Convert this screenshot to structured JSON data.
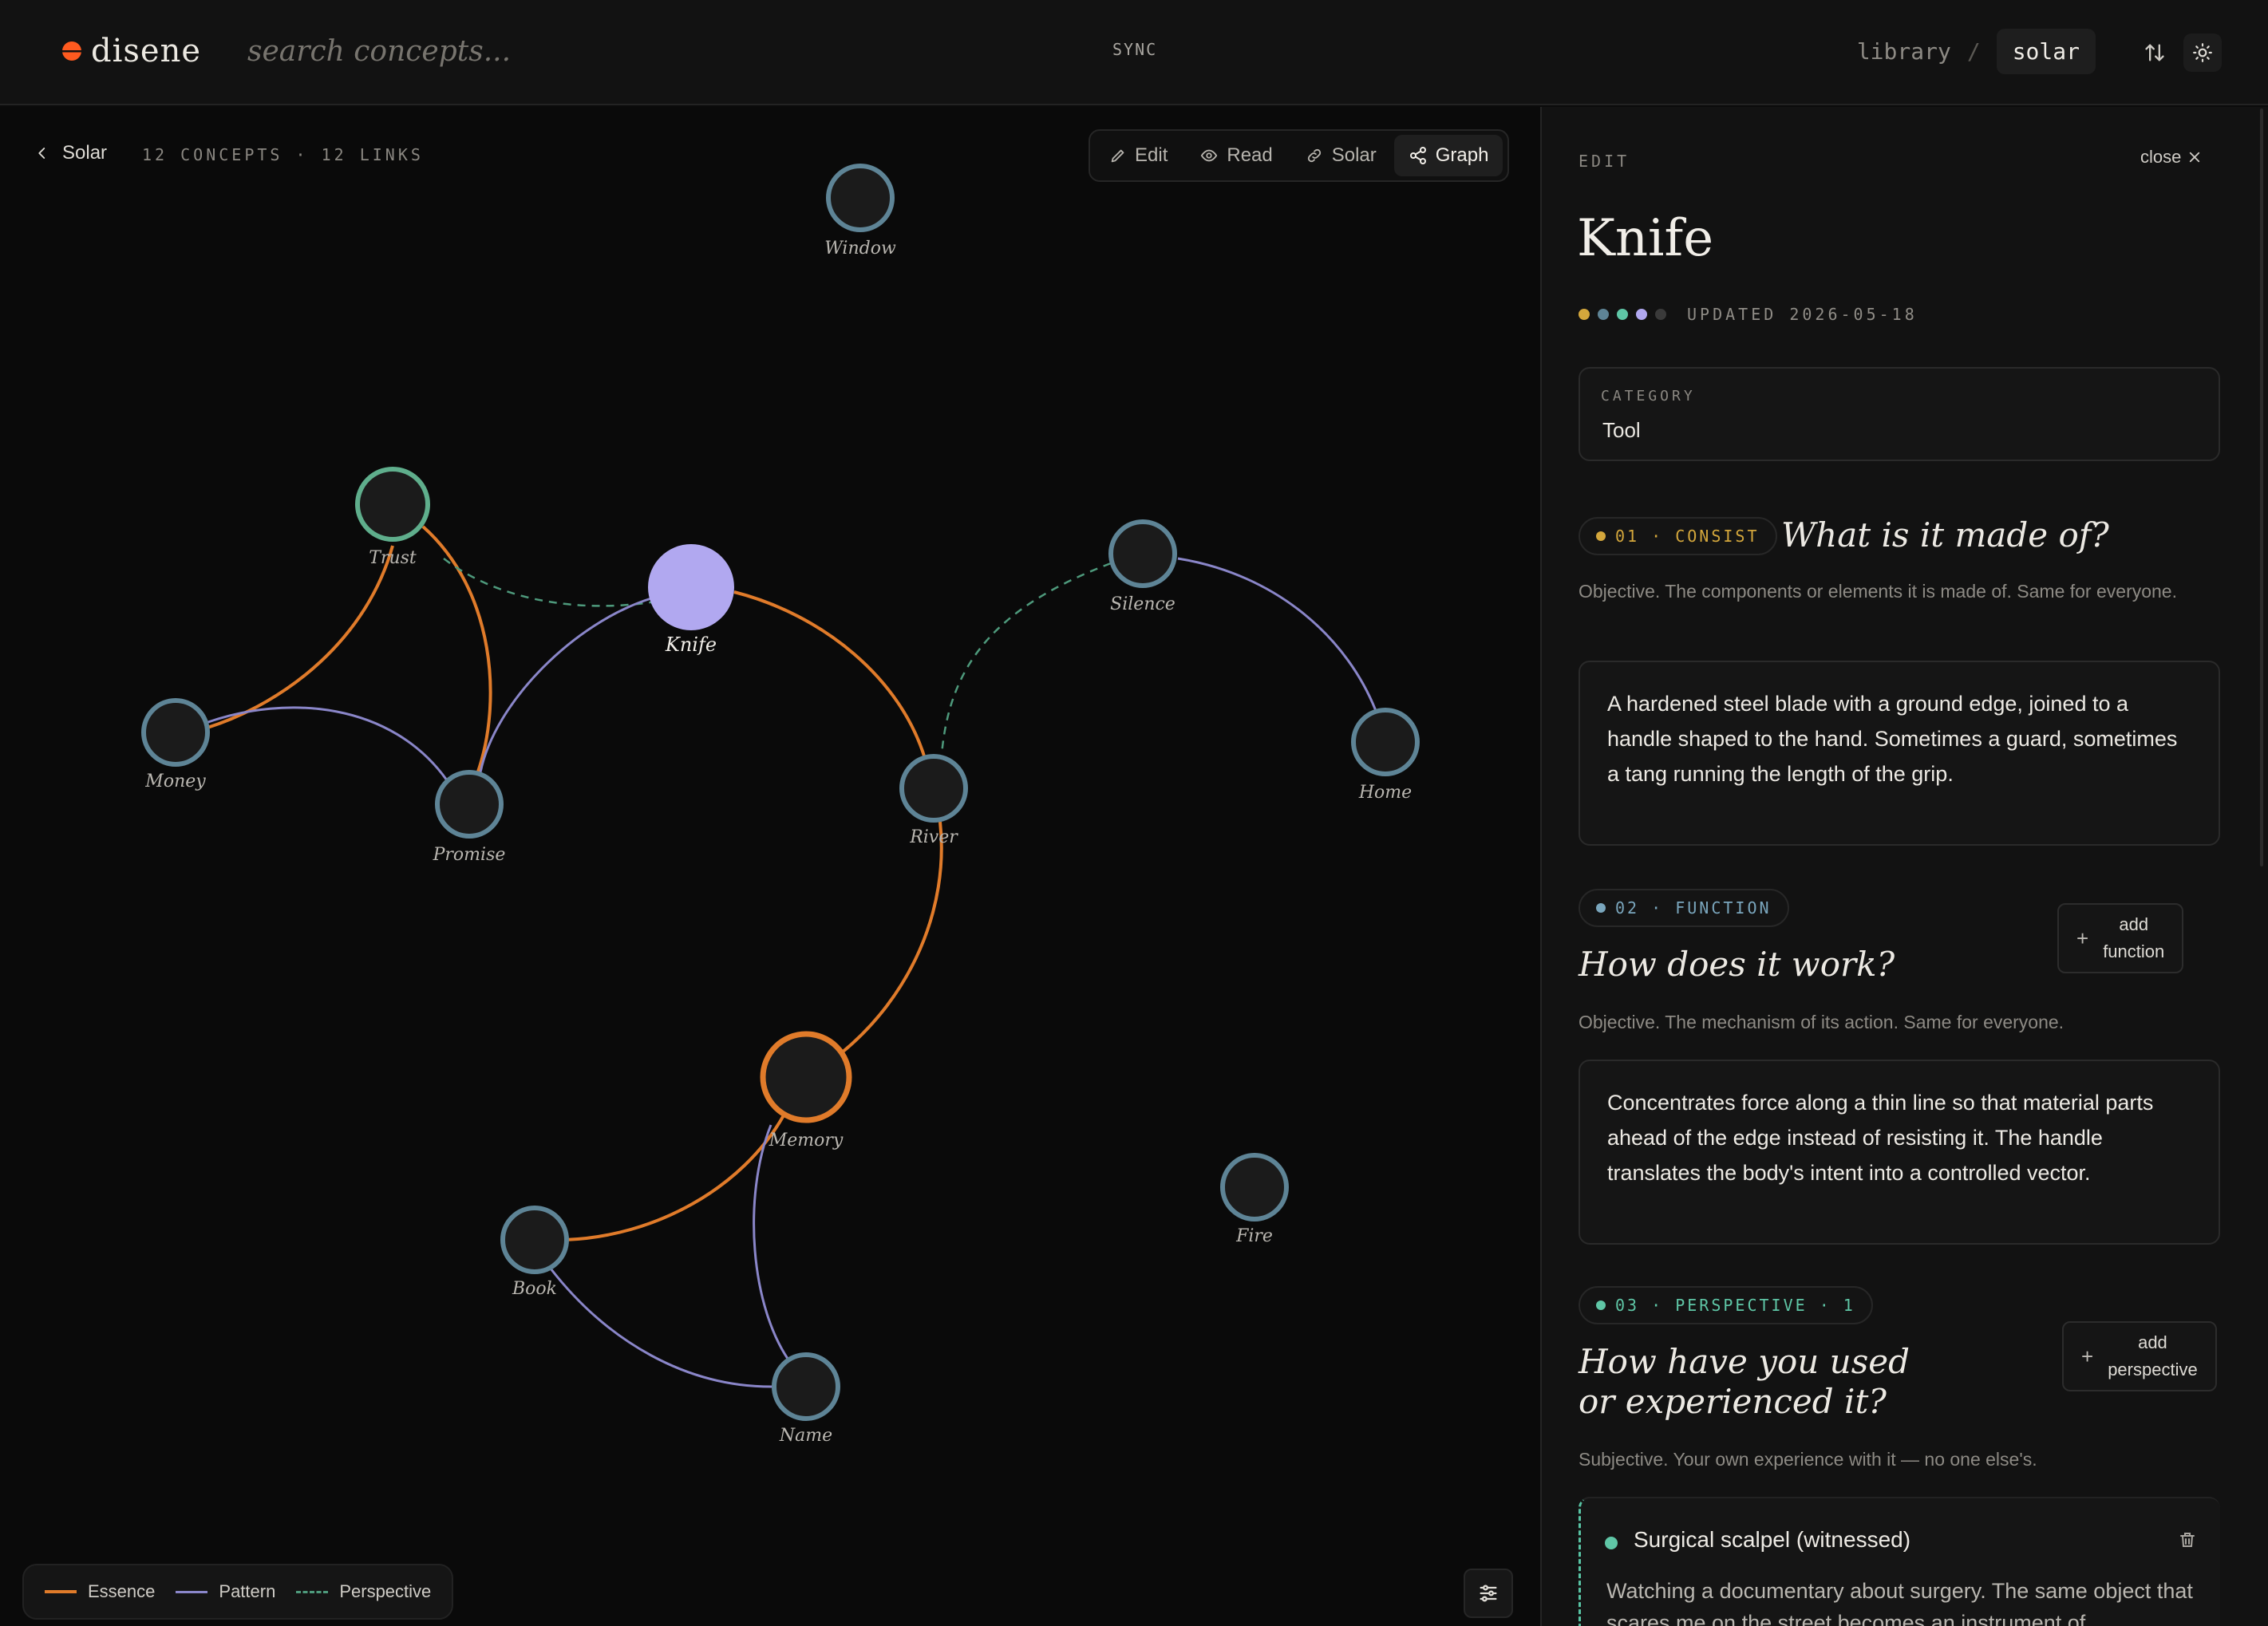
{
  "app": {
    "logo_text": "disene",
    "search_placeholder": "search concepts...",
    "sync_label": "SYNC"
  },
  "breadcrumb": {
    "library": "library",
    "separator": "/",
    "current": "solar"
  },
  "graph_header": {
    "back_label": "Solar",
    "stats": "12 CONCEPTS · 12 LINKS"
  },
  "modes": [
    {
      "label": "Edit",
      "icon": "pencil-icon",
      "active": false
    },
    {
      "label": "Read",
      "icon": "eye-icon",
      "active": false
    },
    {
      "label": "Solar",
      "icon": "link-icon",
      "active": false
    },
    {
      "label": "Graph",
      "icon": "share-icon",
      "active": true
    }
  ],
  "legend": [
    {
      "label": "Essence",
      "color": "#e07b2a",
      "style": "solid"
    },
    {
      "label": "Pattern",
      "color": "#8a86c9",
      "style": "solid"
    },
    {
      "label": "Perspective",
      "color": "#4e9a7c",
      "style": "dashed"
    }
  ],
  "colors": {
    "essence": "#e07b2a",
    "pattern": "#8a86c9",
    "perspective": "#4e9a7c",
    "node_default": "#5e8496",
    "node_trust": "#5fae8c",
    "node_memory": "#e07b2a",
    "node_selected": "#b1a8f0"
  },
  "nodes": [
    {
      "id": "window",
      "label": "Window"
    },
    {
      "id": "trust",
      "label": "Trust"
    },
    {
      "id": "knife",
      "label": "Knife"
    },
    {
      "id": "silence",
      "label": "Silence"
    },
    {
      "id": "money",
      "label": "Money"
    },
    {
      "id": "home",
      "label": "Home"
    },
    {
      "id": "promise",
      "label": "Promise"
    },
    {
      "id": "river",
      "label": "River"
    },
    {
      "id": "memory",
      "label": "Memory"
    },
    {
      "id": "fire",
      "label": "Fire"
    },
    {
      "id": "book",
      "label": "Book"
    },
    {
      "id": "name",
      "label": "Name"
    }
  ],
  "panel": {
    "mode_label": "EDIT",
    "close_label": "close",
    "title": "Knife",
    "status_dots": [
      "#d4a73c",
      "#5e8496",
      "#5fc6a6",
      "#b1a8f0",
      "#3a3a3a"
    ],
    "updated": "UPDATED 2026-05-18",
    "category_label": "CATEGORY",
    "category_value": "Tool",
    "sections": [
      {
        "badge": "01 · CONSIST",
        "badge_color": "#d4a73c",
        "question": "What is it made of?",
        "help": "Objective. The components or elements it is made of. Same for everyone.",
        "text": "A hardened steel blade with a ground edge, joined to a handle shaped to the hand. Sometimes a guard, sometimes a tang running the length of the grip."
      },
      {
        "badge": "02 · FUNCTION",
        "badge_color": "#7aa6bd",
        "question": "How does it work?",
        "help": "Objective. The mechanism of its action. Same for everyone.",
        "text": "Concentrates force along a thin line so that material parts ahead of the edge instead of resisting it. The handle translates the body's intent into a controlled vector.",
        "add_label_1": "add",
        "add_label_2": "function"
      },
      {
        "badge": "03 · PERSPECTIVE · 1",
        "badge_color": "#5fc6a6",
        "question_1": "How have you used",
        "question_2": "or experienced it?",
        "help": "Subjective. Your own experience with it — no one else's.",
        "add_label_1": "add",
        "add_label_2": "perspective",
        "entry_title": "Surgical scalpel (witnessed)",
        "entry_body": "Watching a documentary about surgery. The same object that scares me on the street becomes an instrument of"
      }
    ]
  }
}
